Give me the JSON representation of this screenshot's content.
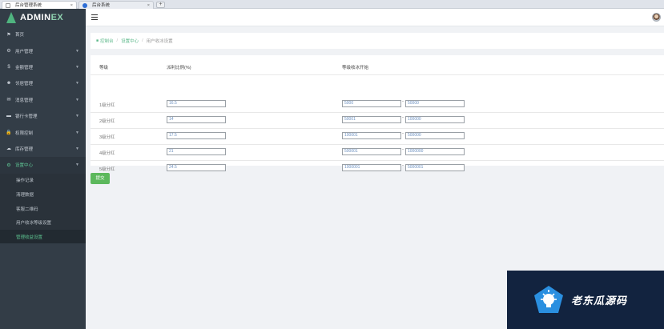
{
  "browser": {
    "tabs": [
      {
        "label": "后台管理系统",
        "close": "×"
      },
      {
        "label": "后台系统",
        "close": "×"
      }
    ],
    "new_tab": "+"
  },
  "sidebar": {
    "logo_main": "ADMIN",
    "logo_accent": "EX",
    "items": [
      {
        "icon": "flag-icon",
        "glyph": "⚑",
        "label": "首页",
        "caret": ""
      },
      {
        "icon": "gear-icon",
        "glyph": "⚙",
        "label": "用户管理",
        "caret": "▼"
      },
      {
        "icon": "dollar-icon",
        "glyph": "$",
        "label": "金额管理",
        "caret": "▼"
      },
      {
        "icon": "users-icon",
        "glyph": "☻",
        "label": "邻居管理",
        "caret": "▼"
      },
      {
        "icon": "megaphone-icon",
        "glyph": "✉",
        "label": "消息管理",
        "caret": "▼"
      },
      {
        "icon": "card-icon",
        "glyph": "▬",
        "label": "银行卡管理",
        "caret": "▼"
      },
      {
        "icon": "lock-icon",
        "glyph": "🔒",
        "label": "权限控制",
        "caret": "▼"
      },
      {
        "icon": "cloud-icon",
        "glyph": "☁",
        "label": "库存管理",
        "caret": "▼"
      },
      {
        "icon": "gear-icon",
        "glyph": "⚙",
        "label": "设置中心",
        "caret": "▼",
        "active": true
      }
    ],
    "sub_items": [
      {
        "label": "操作记录"
      },
      {
        "label": "清理数据"
      },
      {
        "label": "客服二维码"
      },
      {
        "label": "用户收冰等级设置"
      },
      {
        "label": "管理收益设置",
        "current": true
      }
    ]
  },
  "breadcrumb": {
    "home": "控制台",
    "section": "设置中心",
    "current": "用户收冰设置"
  },
  "table": {
    "headers": {
      "level": "等级",
      "ratio": "派利比例(%)",
      "range": "等级收冰开始"
    },
    "rows": [
      {
        "level": "1级分红",
        "ratio": "16.5",
        "from": "5000",
        "to": "50000"
      },
      {
        "level": "2级分红",
        "ratio": "14",
        "from": "50001",
        "to": "100000"
      },
      {
        "level": "3级分红",
        "ratio": "17.5",
        "from": "100001",
        "to": "500000"
      },
      {
        "level": "4级分红",
        "ratio": "21",
        "from": "500001",
        "to": "1000000"
      },
      {
        "level": "5级分红",
        "ratio": "24.5",
        "from": "1000001",
        "to": "5000001"
      }
    ],
    "dash": "-"
  },
  "submit_label": "提交",
  "watermark": {
    "text": "老东瓜源码"
  },
  "colors": {
    "sidebar": "#333d47",
    "accent": "#5cb88a",
    "submit": "#5cb85c",
    "watermark_bg": "#12233f"
  }
}
